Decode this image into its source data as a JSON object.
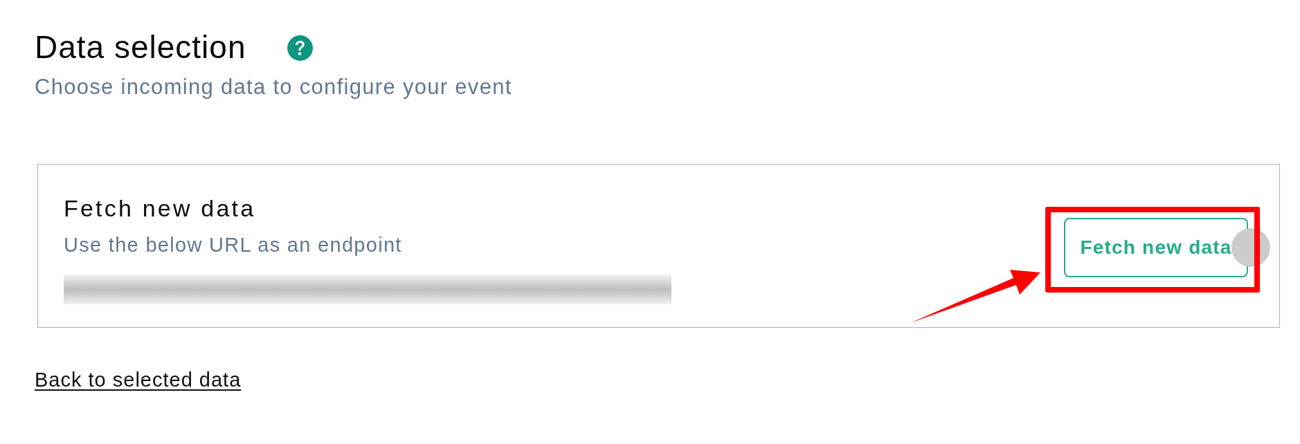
{
  "header": {
    "title": "Data selection",
    "subtitle": "Choose incoming data to configure your event"
  },
  "card": {
    "title": "Fetch new data",
    "description": "Use the below URL as an endpoint",
    "button": {
      "label": "Fetch new data"
    }
  },
  "back_link": {
    "label": "Back to selected data"
  }
}
